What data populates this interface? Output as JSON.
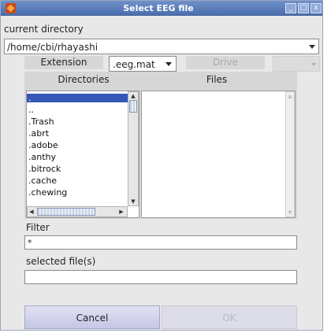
{
  "window": {
    "title": "Select EEG file",
    "controls": {
      "minimize": "_",
      "maximize": "□",
      "close": "x"
    }
  },
  "current_directory": {
    "label": "current directory",
    "value": "/home/cbi/rhayashi"
  },
  "extension": {
    "label": "Extension",
    "value": ".eeg.mat"
  },
  "drive": {
    "label": "Drive"
  },
  "directories": {
    "header": "Directories",
    "items": [
      ".",
      "..",
      ".Trash",
      ".abrt",
      ".adobe",
      ".anthy",
      ".bitrock",
      ".cache",
      ".chewing"
    ]
  },
  "files": {
    "header": "Files",
    "items": []
  },
  "filter": {
    "label": "Filter",
    "value": "*"
  },
  "selected": {
    "label": "selected file(s)",
    "value": ""
  },
  "buttons": {
    "cancel": "Cancel",
    "ok": "OK"
  }
}
